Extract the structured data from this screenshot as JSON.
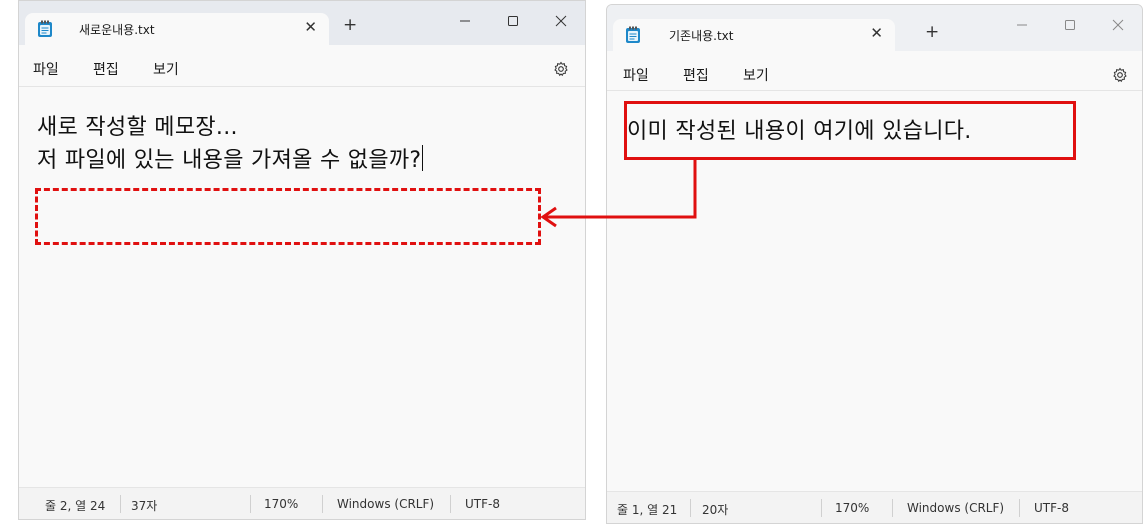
{
  "left_window": {
    "tab_title": "새로운내용.txt",
    "menu": [
      "파일",
      "편집",
      "보기"
    ],
    "lines": [
      "새로 작성할 메모장...",
      "저 파일에 있는 내용을 가져올 수 없을까?"
    ],
    "status": {
      "position": "줄 2, 열 24",
      "chars": "37자",
      "zoom": "170%",
      "line_ending": "Windows (CRLF)",
      "encoding": "UTF-8"
    }
  },
  "right_window": {
    "tab_title": "기존내용.txt",
    "menu": [
      "파일",
      "편집",
      "보기"
    ],
    "lines": [
      "이미 작성된 내용이 여기에 있습니다."
    ],
    "status": {
      "position": "줄 1, 열 21",
      "chars": "20자",
      "zoom": "170%",
      "line_ending": "Windows (CRLF)",
      "encoding": "UTF-8"
    }
  },
  "icons": {
    "app": "notepad-icon",
    "close": "close-icon",
    "add": "plus-icon",
    "minimize": "minimize-icon",
    "maximize": "maximize-icon",
    "settings": "gear-icon"
  },
  "colors": {
    "annotation": "#e01010",
    "notepad_icon": "#1e88c9"
  }
}
